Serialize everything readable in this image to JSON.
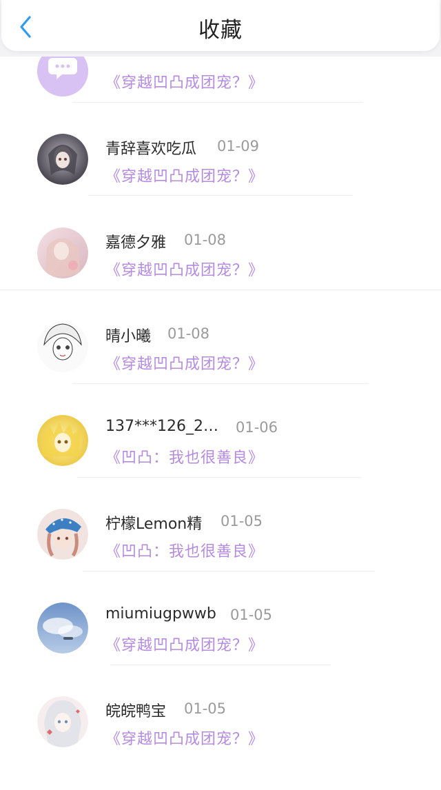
{
  "header": {
    "title": "收藏",
    "back_icon": "chevron-left-icon",
    "accent": "#2f9bf0"
  },
  "colors": {
    "name": "#2b2b2b",
    "date": "#9a9a9a",
    "book": "#b58be0"
  },
  "items": [
    {
      "name": "",
      "date": "",
      "book": "《穿越凹凸成团宠？》",
      "avatar": "chat-bubble-icon"
    },
    {
      "name": "青辞喜欢吃瓜",
      "date": "01-09",
      "book": "《穿越凹凸成团宠？》",
      "avatar": "anime-avatar-dark"
    },
    {
      "name": "嘉德夕雅",
      "date": "01-08",
      "book": "《穿越凹凸成团宠？》",
      "avatar": "anime-avatar-pink"
    },
    {
      "name": "晴小曦",
      "date": "01-08",
      "book": "《穿越凹凸成团宠？》",
      "avatar": "anime-avatar-white"
    },
    {
      "name": "137***126_2…",
      "date": "01-06",
      "book": "《凹凸：我也很善良》",
      "avatar": "anime-avatar-yellow"
    },
    {
      "name": "柠檬Lemon精",
      "date": "01-05",
      "book": "《凹凸：我也很善良》",
      "avatar": "anime-avatar-bandana"
    },
    {
      "name": "miumiugpwwb",
      "date": "01-05",
      "book": "《穿越凹凸成团宠？》",
      "avatar": "sky-avatar"
    },
    {
      "name": "皖皖鸭宝",
      "date": "01-05",
      "book": "《穿越凹凸成团宠？》",
      "avatar": "anime-avatar-silver"
    }
  ]
}
